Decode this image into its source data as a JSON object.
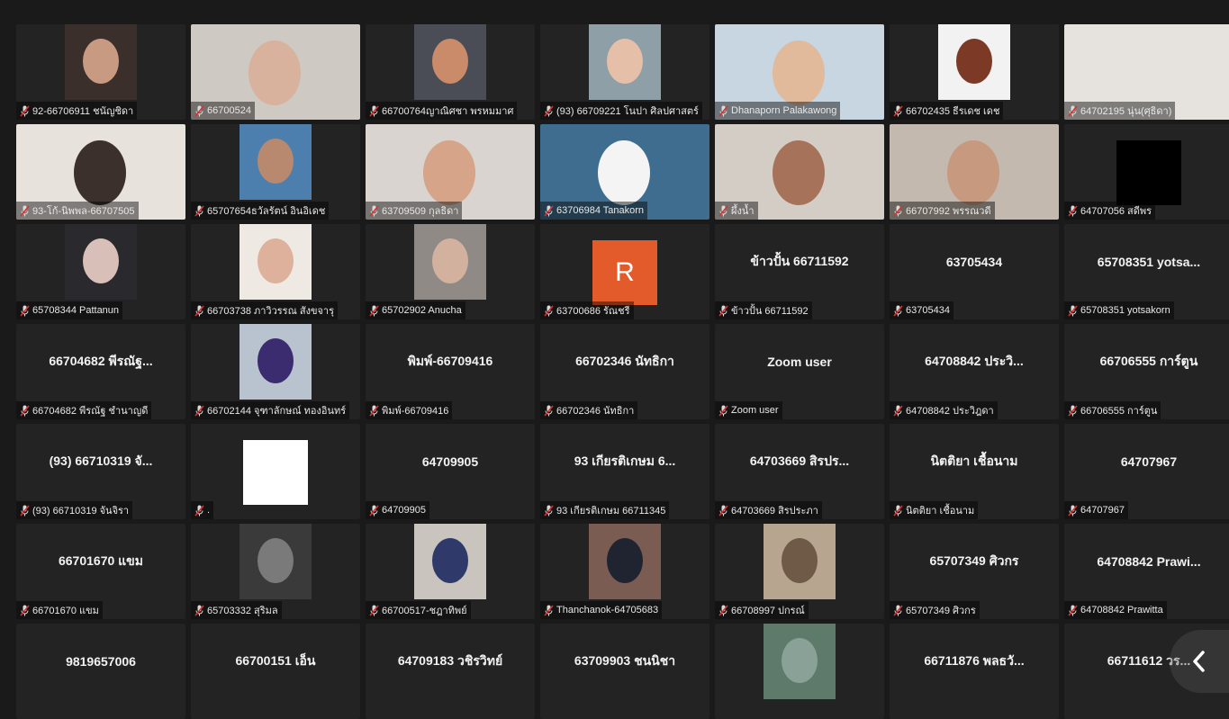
{
  "tiles": [
    {
      "label": "92-66706911 ชนัญชิดา",
      "type": "photo",
      "bg": "#3a2f2b",
      "skin": "#c99a82"
    },
    {
      "label": "66700524",
      "type": "wide",
      "bg": "#cfc9c4",
      "skin": "#d8b29d"
    },
    {
      "label": "66700764ญาณิศชา พรหมมาศ",
      "type": "photo",
      "bg": "#4a4d55",
      "skin": "#c98b6a"
    },
    {
      "label": "(93) 66709221 โนปา ศิลปศาสตร์",
      "type": "photo",
      "bg": "#8f9fa8",
      "skin": "#e5bfa7"
    },
    {
      "label": "Dhanaporn Palakawong",
      "type": "wide",
      "bg": "#c7d6e0",
      "skin": "#e1b99b"
    },
    {
      "label": "66702435 ธีรเดช เดช",
      "type": "photo",
      "bg": "#f2f2f2",
      "skin": "#7c3a26"
    },
    {
      "label": "64702195 นุ่น(ศุธิดา)",
      "type": "wide",
      "bg": "#e6e3df",
      "skin": "#e6e3df"
    },
    {
      "label": "93-โก้-นิพพล-66707505",
      "type": "wide",
      "bg": "#e8e2dc",
      "skin": "#3b302b"
    },
    {
      "label": "65707654ธวัลรัตน์ อินอิเดช",
      "type": "photo",
      "bg": "#4d7fae",
      "skin": "#b8896f"
    },
    {
      "label": "63709509 กุลธิดา",
      "type": "wide",
      "bg": "#d9d4cf",
      "skin": "#d6a488"
    },
    {
      "label": "63706984 Tanakorn",
      "type": "wide",
      "bg": "#3f6d8f",
      "skin": "#f4f4f4"
    },
    {
      "label": "ผึ้งน้ำ",
      "type": "wide",
      "bg": "#d4cdc6",
      "skin": "#a7725a"
    },
    {
      "label": "66707992 พรรณวดี",
      "type": "wide",
      "bg": "#c4b9ae",
      "skin": "#c7997f"
    },
    {
      "label": "64707056 สดีพร",
      "type": "black",
      "bg": "#000000",
      "skin": "#000000"
    },
    {
      "label": "65708344 Pattanun",
      "type": "photo",
      "bg": "#2a2a2e",
      "skin": "#d8c0b8"
    },
    {
      "label": "66703738 ภาวิวรรณ สังขจารุ",
      "type": "photo",
      "bg": "#efe9e4",
      "skin": "#ddb19b"
    },
    {
      "label": "65702902 Anucha",
      "type": "photo",
      "bg": "#8f8a86",
      "skin": "#d3b19f"
    },
    {
      "label": "63700686 รัณชรี",
      "type": "avatar",
      "letter": "R",
      "bg": "#e35b2a",
      "skin": "#e35b2a"
    },
    {
      "label": "ข้าวปั้น 66711592",
      "type": "name",
      "bigname": "ข้าวปั้น 66711592"
    },
    {
      "label": "63705434",
      "type": "name",
      "bigname": "63705434"
    },
    {
      "label": "65708351 yotsakorn",
      "type": "name",
      "bigname": "65708351 yotsa..."
    },
    {
      "label": "66704682 พีรณัฐ ชำนาญดี",
      "type": "name",
      "bigname": "66704682 พีรณัฐ..."
    },
    {
      "label": "66702144 จุฑาลักษณ์ ทองอินทร์",
      "type": "photo",
      "bg": "#b9c3d0",
      "skin": "#3a2c6e"
    },
    {
      "label": "พิมพ์-66709416",
      "type": "name",
      "bigname": "พิมพ์-66709416"
    },
    {
      "label": "66702346 นัทธิกา",
      "type": "name",
      "bigname": "66702346 นัทธิกา"
    },
    {
      "label": "Zoom user",
      "type": "name",
      "bigname": "Zoom user"
    },
    {
      "label": "64708842 ประวิฎดา",
      "type": "name",
      "bigname": "64708842 ประวิ..."
    },
    {
      "label": "66706555 การ์ตูน",
      "type": "name",
      "bigname": "66706555 การ์ตูน"
    },
    {
      "label": "(93) 66710319 จันจิรา",
      "type": "name",
      "bigname": "(93) 66710319 จั..."
    },
    {
      "label": ".",
      "type": "white",
      "bg": "#ffffff",
      "skin": "#ffffff"
    },
    {
      "label": "64709905",
      "type": "name",
      "bigname": "64709905"
    },
    {
      "label": "93 เกียรติเกษม 66711345",
      "type": "name",
      "bigname": "93 เกียรติเกษม 6..."
    },
    {
      "label": "64703669 สิรประภา",
      "type": "name",
      "bigname": "64703669 สิรปร..."
    },
    {
      "label": "นิตติยา เชื้อนาม",
      "type": "name",
      "bigname": "นิตติยา เชื้อนาม"
    },
    {
      "label": "64707967",
      "type": "name",
      "bigname": "64707967"
    },
    {
      "label": "66701670 แขม",
      "type": "name",
      "bigname": "66701670 แขม"
    },
    {
      "label": "65703332 สุริมล",
      "type": "photo",
      "bg": "#3a3a3a",
      "skin": "#7a7a7a"
    },
    {
      "label": "66700517-ชฎาทิพย์",
      "type": "photo",
      "bg": "#c9c4bd",
      "skin": "#2f3a6b"
    },
    {
      "label": "Thanchanok-64705683",
      "type": "photo",
      "bg": "#7a5c52",
      "skin": "#1f2430"
    },
    {
      "label": "66708997 ปกรณ์",
      "type": "photo",
      "bg": "#b8a590",
      "skin": "#6e5a47"
    },
    {
      "label": "65707349 ศิวกร",
      "type": "name",
      "bigname": "65707349 ศิวกร"
    },
    {
      "label": "64708842 Prawitta",
      "type": "name",
      "bigname": "64708842 Prawi..."
    },
    {
      "label": "",
      "type": "name",
      "bigname": "9819657006"
    },
    {
      "label": "",
      "type": "name",
      "bigname": "66700151 เอ็น"
    },
    {
      "label": "",
      "type": "name",
      "bigname": "64709183 วชิรวิทย์"
    },
    {
      "label": "",
      "type": "name",
      "bigname": "63709903 ชนนิชา"
    },
    {
      "label": "",
      "type": "photo",
      "bg": "#5e7a6a",
      "skin": "#8aa198"
    },
    {
      "label": "",
      "type": "name",
      "bigname": "66711876 พลธวั..."
    },
    {
      "label": "",
      "type": "name",
      "bigname": "66711612 วร..."
    }
  ],
  "controls": {
    "collapse_icon": "chevron-left-icon"
  }
}
